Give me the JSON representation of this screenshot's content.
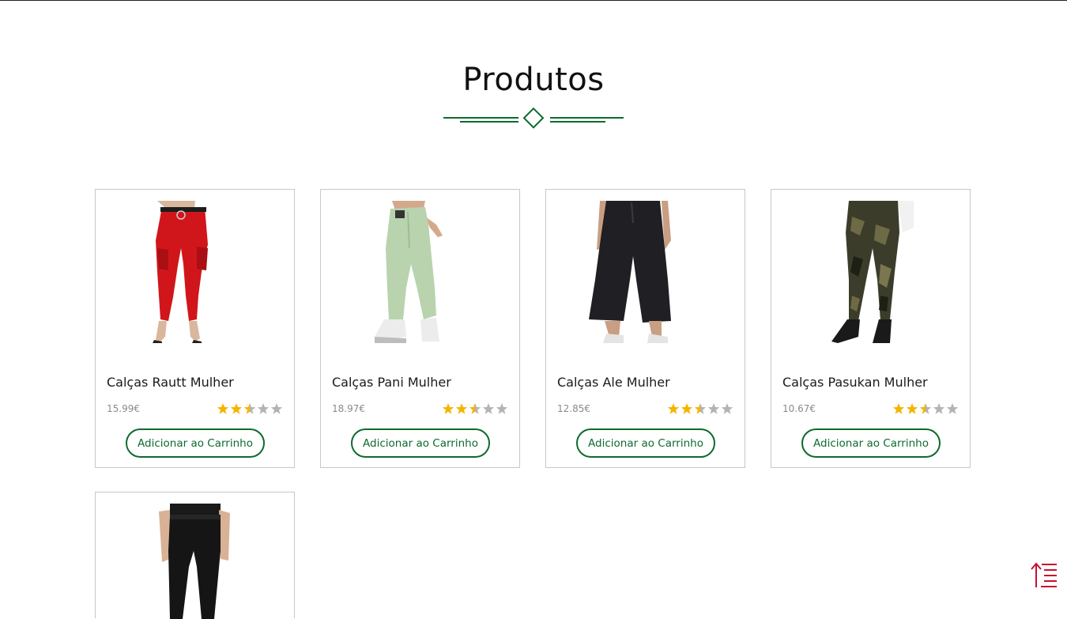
{
  "section": {
    "title": "Produtos"
  },
  "colors": {
    "accent": "#0d6b2e",
    "star_filled": "#f5b400",
    "star_empty": "#b3b3b3",
    "scroll_icon": "#c8102e"
  },
  "products": [
    {
      "name": "Calças Rautt Mulher",
      "price": "15.99€",
      "rating": 2.5,
      "rating_max": 5,
      "button_label": "Adicionar ao Carrinho",
      "image": "red-cargo-pants"
    },
    {
      "name": "Calças Pani Mulher",
      "price": "18.97€",
      "rating": 2.5,
      "rating_max": 5,
      "button_label": "Adicionar ao Carrinho",
      "image": "mint-pleated-pants"
    },
    {
      "name": "Calças Ale Mulher",
      "price": "12.85€",
      "rating": 2.5,
      "rating_max": 5,
      "button_label": "Adicionar ao Carrinho",
      "image": "black-culottes"
    },
    {
      "name": "Calças Pasukan Mulher",
      "price": "10.67€",
      "rating": 2.5,
      "rating_max": 5,
      "button_label": "Adicionar ao Carrinho",
      "image": "camo-leggings"
    },
    {
      "image": "black-skinny-pants"
    }
  ],
  "scroll_to_top": {
    "icon": "scroll-top-icon"
  }
}
